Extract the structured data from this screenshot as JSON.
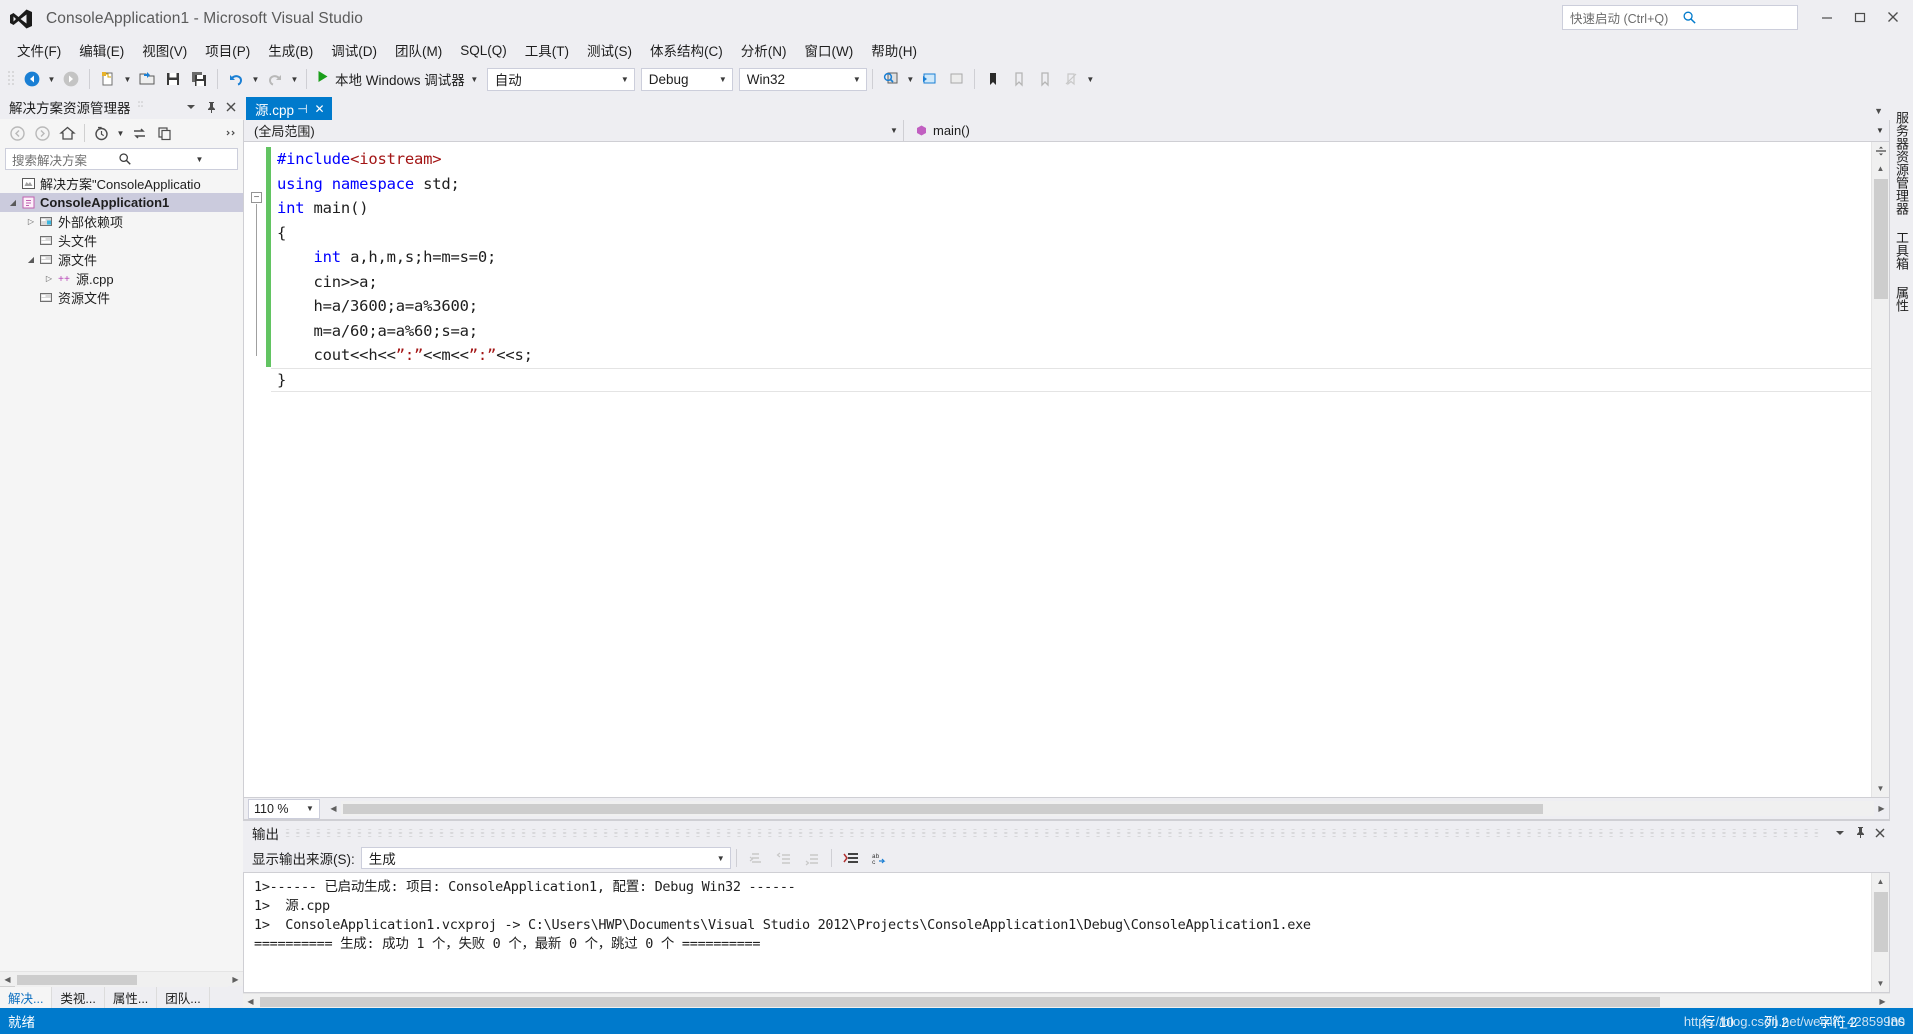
{
  "window": {
    "title": "ConsoleApplication1 - Microsoft Visual Studio",
    "logo_icon": "visual-studio-logo",
    "quick_launch_placeholder": "快速启动 (Ctrl+Q)",
    "quick_launch_value": "",
    "search_icon": "search-icon",
    "minimize_label": "—",
    "maximize_label": "❐",
    "close_label": "✕",
    "accent_color": "#007acc",
    "chrome_color": "#eeeef2"
  },
  "menubar": {
    "items": [
      {
        "label": "文件(F)",
        "name": "menu-file"
      },
      {
        "label": "编辑(E)",
        "name": "menu-edit"
      },
      {
        "label": "视图(V)",
        "name": "menu-view"
      },
      {
        "label": "项目(P)",
        "name": "menu-project"
      },
      {
        "label": "生成(B)",
        "name": "menu-build"
      },
      {
        "label": "调试(D)",
        "name": "menu-debug"
      },
      {
        "label": "团队(M)",
        "name": "menu-team"
      },
      {
        "label": "SQL(Q)",
        "name": "menu-sql"
      },
      {
        "label": "工具(T)",
        "name": "menu-tools"
      },
      {
        "label": "测试(S)",
        "name": "menu-test"
      },
      {
        "label": "体系结构(C)",
        "name": "menu-architecture"
      },
      {
        "label": "分析(N)",
        "name": "menu-analyze"
      },
      {
        "label": "窗口(W)",
        "name": "menu-window"
      },
      {
        "label": "帮助(H)",
        "name": "menu-help"
      }
    ]
  },
  "toolbar": {
    "navigate_back_icon": "navigate-back-icon",
    "navigate_forward_icon": "navigate-forward-icon",
    "new_item_icon": "new-item-icon",
    "open_file_icon": "open-file-icon",
    "save_icon": "save-icon",
    "save_all_icon": "save-all-icon",
    "undo_icon": "undo-icon",
    "redo_icon": "redo-icon",
    "start_debug_icon": "start-debug-play-icon",
    "start_debug_label": "本地 Windows 调试器",
    "platform_toolset": "自动",
    "configuration": "Debug",
    "platform": "Win32",
    "find_icon": "find-in-files-icon",
    "comment_icon": "comment-selection-icon",
    "step_icon": "step-icon",
    "bookmark_icon": "bookmark-icon",
    "more_icon": "overflow-chevron-icon"
  },
  "solution_explorer": {
    "title": "解决方案资源管理器",
    "float_icon": "window-dropdown-icon",
    "pin_icon": "pin-icon",
    "close_icon": "close-icon",
    "back_icon": "back-icon",
    "forward_icon": "forward-icon",
    "home_icon": "home-icon",
    "pending_changes_icon": "pending-changes-icon",
    "sync_icon": "sync-with-active-document-icon",
    "show_all_files_icon": "show-all-files-icon",
    "overflow_icon": "toolbar-overflow-icon",
    "search_placeholder": "搜索解决方案资源管理器(C",
    "search_value": "",
    "search_icon": "search-icon",
    "search_dropdown_icon": "chevron-down-icon",
    "tree": [
      {
        "label": "解决方案\"ConsoleApplicatio",
        "indent": 0,
        "twisty": "",
        "icon": "solution-icon",
        "bold": false,
        "selected": false
      },
      {
        "label": "ConsoleApplication1",
        "indent": 1,
        "twisty": "expanded",
        "icon": "cpp-project-icon",
        "bold": true,
        "selected": true
      },
      {
        "label": "外部依赖项",
        "indent": 2,
        "twisty": "collapsed",
        "icon": "folder-icon",
        "bold": false,
        "selected": false
      },
      {
        "label": "头文件",
        "indent": 3,
        "twisty": "",
        "icon": "folder-icon",
        "bold": false,
        "selected": false
      },
      {
        "label": "源文件",
        "indent": 2,
        "twisty": "expanded",
        "icon": "folder-icon",
        "bold": false,
        "selected": false
      },
      {
        "label": "源.cpp",
        "indent": 3,
        "twisty": "collapsed",
        "icon": "cpp-file-icon",
        "bold": false,
        "selected": false
      },
      {
        "label": "资源文件",
        "indent": 3,
        "twisty": "",
        "icon": "folder-icon",
        "bold": false,
        "selected": false
      }
    ],
    "bottom_tabs": [
      {
        "label": "解决...",
        "active": true
      },
      {
        "label": "类视...",
        "active": false
      },
      {
        "label": "属性...",
        "active": false
      },
      {
        "label": "团队...",
        "active": false
      }
    ]
  },
  "editor": {
    "tab_label": "源.cpp",
    "tab_pin_icon": "pin-icon",
    "tab_close_icon": "close-icon",
    "tabs_overflow_icon": "chevron-down-icon",
    "scope_combo": "(全局范围)",
    "member_combo": "main()",
    "member_icon": "method-icon",
    "zoom_level": "110 %",
    "code_lines": [
      {
        "n": 1,
        "fold": "",
        "segments": [
          {
            "t": "#include",
            "c": "pre"
          },
          {
            "t": "<iostream>",
            "c": "inc"
          }
        ]
      },
      {
        "n": 2,
        "fold": "",
        "segments": [
          {
            "t": "using namespace",
            "c": "kw"
          },
          {
            "t": " std;",
            "c": ""
          }
        ]
      },
      {
        "n": 3,
        "fold": "minus",
        "segments": [
          {
            "t": "int",
            "c": "kw"
          },
          {
            "t": " main()",
            "c": ""
          }
        ]
      },
      {
        "n": 4,
        "fold": "",
        "segments": [
          {
            "t": "{",
            "c": ""
          }
        ]
      },
      {
        "n": 5,
        "fold": "",
        "segments": [
          {
            "t": "    ",
            "c": ""
          },
          {
            "t": "int",
            "c": "kw"
          },
          {
            "t": " a,h,m,s;h=m=s=0;",
            "c": ""
          }
        ]
      },
      {
        "n": 6,
        "fold": "",
        "segments": [
          {
            "t": "    cin>>a;",
            "c": ""
          }
        ]
      },
      {
        "n": 7,
        "fold": "",
        "segments": [
          {
            "t": "    h=a/3600;a=a%3600;",
            "c": ""
          }
        ]
      },
      {
        "n": 8,
        "fold": "",
        "segments": [
          {
            "t": "    m=a/60;a=a%60;s=a;",
            "c": ""
          }
        ]
      },
      {
        "n": 9,
        "fold": "",
        "segments": [
          {
            "t": "    cout<<h<<",
            "c": ""
          },
          {
            "t": "”:”",
            "c": "str"
          },
          {
            "t": "<<m<<",
            "c": ""
          },
          {
            "t": "”:”",
            "c": "str"
          },
          {
            "t": "<<s;",
            "c": ""
          }
        ]
      },
      {
        "n": 10,
        "fold": "",
        "segments": [
          {
            "t": "}",
            "c": ""
          }
        ],
        "current": true
      }
    ]
  },
  "output_panel": {
    "title": "输出",
    "source_label": "显示输出来源(S):",
    "source_value": "生成",
    "pin_icon": "pin-icon",
    "close_icon": "close-icon",
    "dropdown_icon": "chevron-down-icon",
    "toolbar_icons": [
      "goto-message-icon",
      "previous-message-icon",
      "next-message-icon",
      "clear-all-icon",
      "toggle-word-wrap-icon"
    ],
    "lines": [
      "1>------ 已启动生成: 项目: ConsoleApplication1, 配置: Debug Win32 ------",
      "1>  源.cpp",
      "1>  ConsoleApplication1.vcxproj -> C:\\Users\\HWP\\Documents\\Visual Studio 2012\\Projects\\ConsoleApplication1\\Debug\\ConsoleApplication1.exe",
      "========== 生成: 成功 1 个，失败 0 个，最新 0 个，跳过 0 个 =========="
    ]
  },
  "right_sidebar": {
    "tabs": [
      {
        "label": "服务器资源管理器",
        "name": "server-explorer"
      },
      {
        "label": "工具箱",
        "name": "toolbox"
      },
      {
        "label": "属性",
        "name": "properties"
      }
    ]
  },
  "statusbar": {
    "status": "就绪",
    "line_label": "行 10",
    "col_label": "列 2",
    "char_label": "字符 2",
    "insert_label": "Ins",
    "watermark": "https://blog.csdn.net/weixin_42859980"
  }
}
